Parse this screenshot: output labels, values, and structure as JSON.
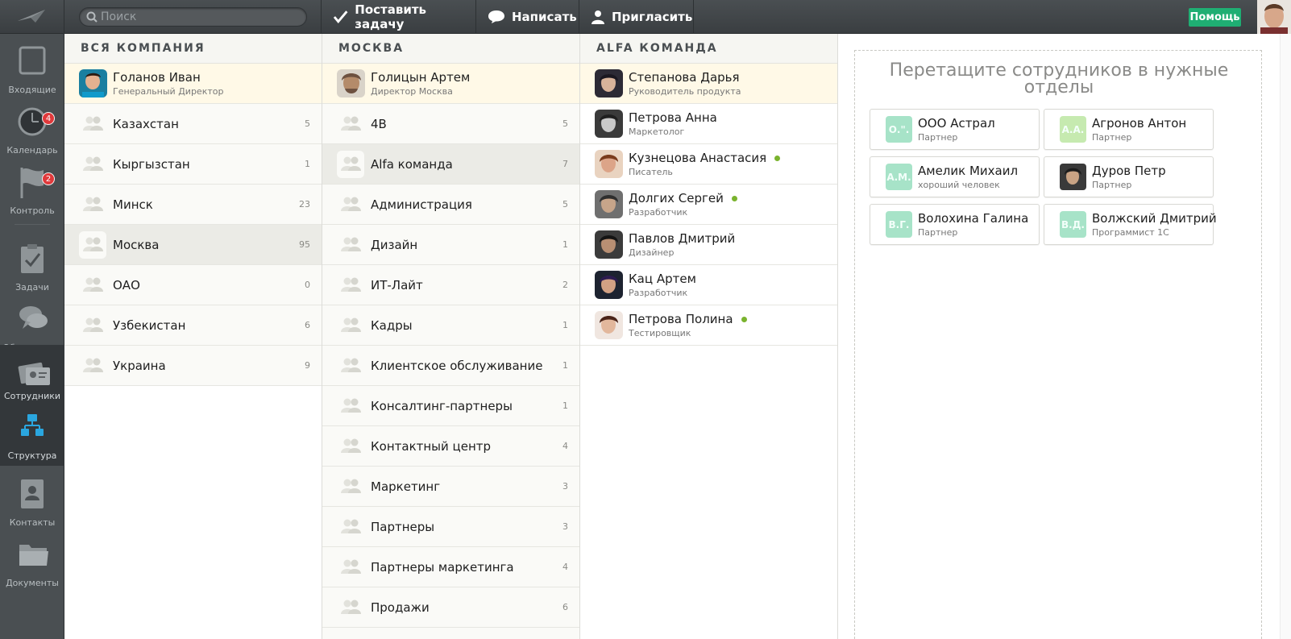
{
  "search": {
    "placeholder": "Поиск"
  },
  "toolbar": {
    "task_label": "Поставить задачу",
    "write_label": "Написать",
    "invite_label": "Пригласить",
    "help_label": "Помощь"
  },
  "sidebar": {
    "items": [
      {
        "label": "Входящие",
        "icon": "inbox-icon"
      },
      {
        "label": "Календарь",
        "icon": "clock-icon",
        "badge": "4"
      },
      {
        "label": "Контроль",
        "icon": "flag-icon",
        "badge": "2"
      },
      {
        "label": "Задачи",
        "icon": "task-icon"
      },
      {
        "label": "Обсуждения",
        "icon": "chat-icon"
      },
      {
        "label": "Сотрудники",
        "icon": "employees-icon"
      },
      {
        "label": "Структура",
        "icon": "structure-icon"
      },
      {
        "label": "Контакты",
        "icon": "contacts-icon"
      },
      {
        "label": "Документы",
        "icon": "folder-icon"
      }
    ]
  },
  "col1": {
    "header": "ВСЯ КОМПАНИЯ",
    "lead": {
      "name": "Голанов Иван",
      "title": "Генеральный Директор"
    },
    "groups": [
      {
        "name": "Казахстан",
        "count": "5"
      },
      {
        "name": "Кыргызстан",
        "count": "1"
      },
      {
        "name": "Минск",
        "count": "23"
      },
      {
        "name": "Москва",
        "count": "95"
      },
      {
        "name": "ОАО",
        "count": "0"
      },
      {
        "name": "Узбекистан",
        "count": "6"
      },
      {
        "name": "Украина",
        "count": "9"
      }
    ]
  },
  "col2": {
    "header": "МОСКВА",
    "lead": {
      "name": "Голицын Артем",
      "title": "Директор Москва"
    },
    "groups": [
      {
        "name": "4B",
        "count": "5"
      },
      {
        "name": "Alfa команда",
        "count": "7"
      },
      {
        "name": "Администрация",
        "count": "5"
      },
      {
        "name": "Дизайн",
        "count": "1"
      },
      {
        "name": "ИТ-Лайт",
        "count": "2"
      },
      {
        "name": "Кадры",
        "count": "1"
      },
      {
        "name": "Клиентское обслуживание",
        "count": "1"
      },
      {
        "name": "Консалтинг-партнеры",
        "count": "1"
      },
      {
        "name": "Контактный центр",
        "count": "4"
      },
      {
        "name": "Маркетинг",
        "count": "3"
      },
      {
        "name": "Партнеры",
        "count": "3"
      },
      {
        "name": "Партнеры маркетинга",
        "count": "4"
      },
      {
        "name": "Продажи",
        "count": "6"
      }
    ]
  },
  "col3": {
    "header": "ALFA КОМАНДА",
    "members": [
      {
        "name": "Степанова Дарья",
        "title": "Руководитель продукта"
      },
      {
        "name": "Петрова Анна",
        "title": "Маркетолог"
      },
      {
        "name": "Кузнецова Анастасия",
        "title": "Писатель"
      },
      {
        "name": "Долгих Сергей",
        "title": "Разработчик"
      },
      {
        "name": "Павлов Дмитрий",
        "title": "Дизайнер"
      },
      {
        "name": "Кац Артем",
        "title": "Разработчик"
      },
      {
        "name": "Петрова Полина",
        "title": "Тестировщик"
      }
    ]
  },
  "drop": {
    "title": "Перетащите сотрудников в нужные отделы",
    "cards": [
      {
        "initials": "О.\".",
        "name": "ООО Астрал",
        "role": "Партнер"
      },
      {
        "initials": "А.А.",
        "name": "Агронов Антон",
        "role": "Партнер"
      },
      {
        "initials": "А.М.",
        "name": "Амелик Михаил",
        "role": "хороший человек"
      },
      {
        "initials": "",
        "name": "Дуров Петр",
        "role": "Партнер"
      },
      {
        "initials": "В.Г.",
        "name": "Волохина Галина",
        "role": "Партнер"
      },
      {
        "initials": "В.Д.",
        "name": "Волжский Дмитрий",
        "role": "Программист 1С"
      }
    ]
  },
  "colors": {
    "accent_green": "#1fae73",
    "badge_red": "#e0393b",
    "online_green": "#7ab32e",
    "nav_active": "#2aa6df"
  }
}
